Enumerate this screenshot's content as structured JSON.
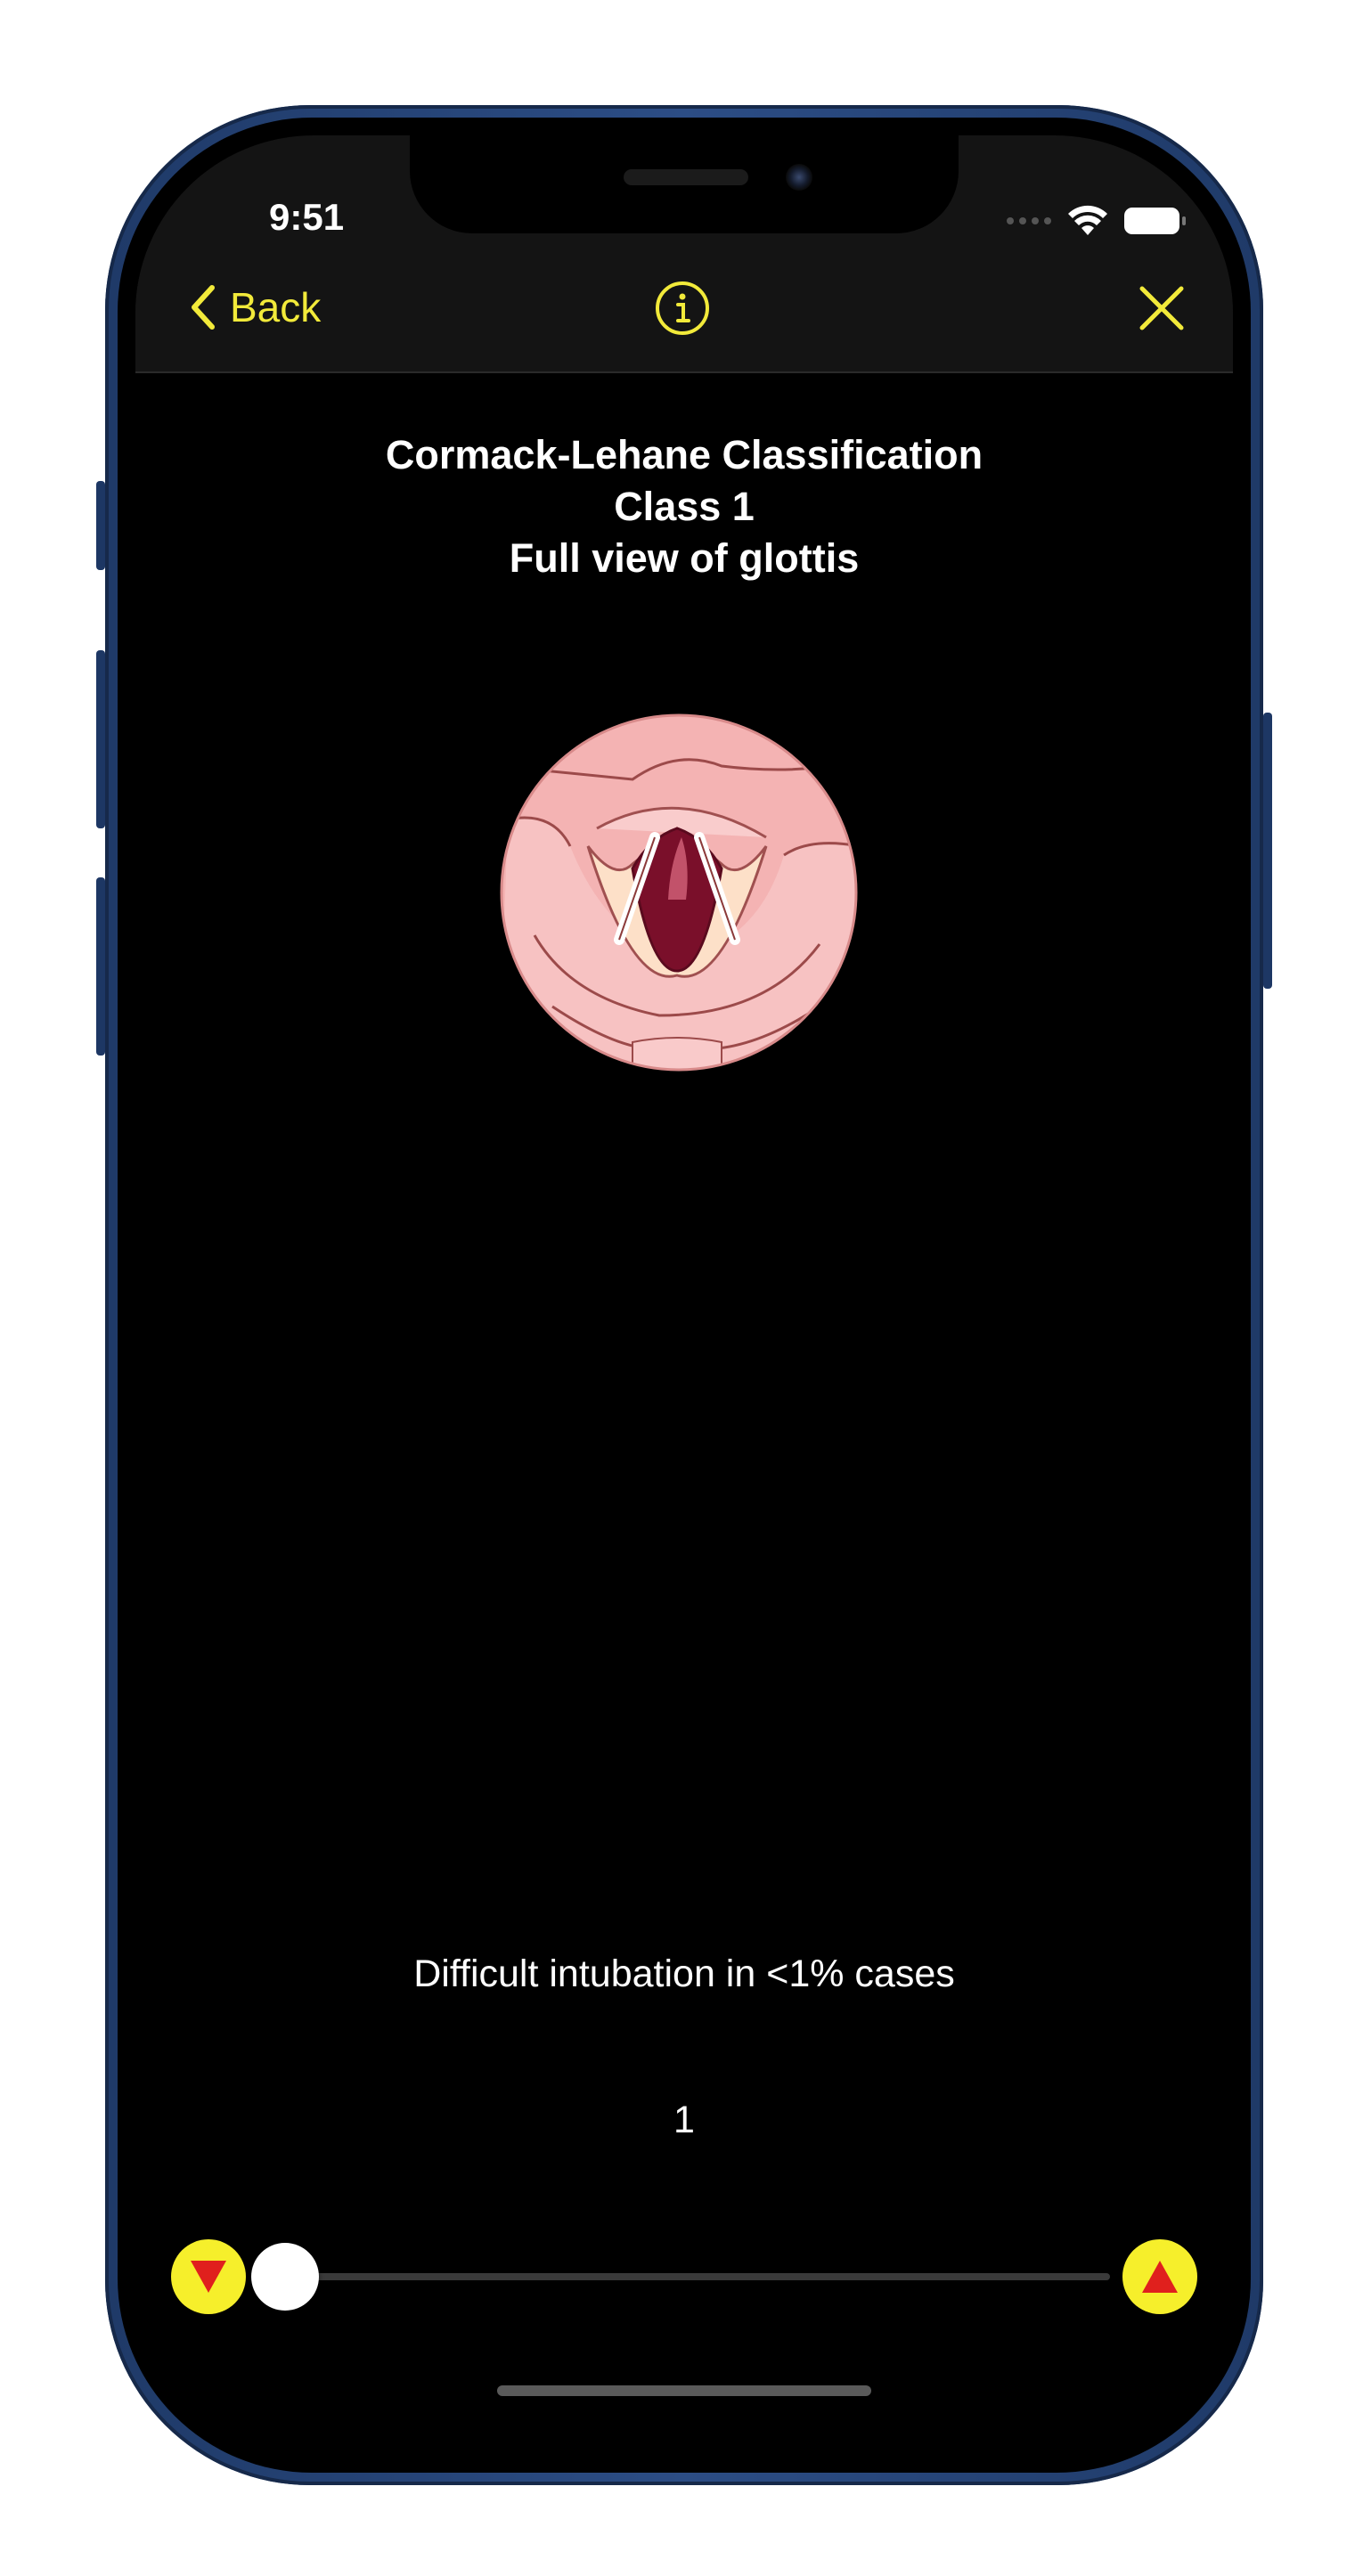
{
  "status_bar": {
    "time": "9:51",
    "signal_icon": "cellular-dots-icon",
    "wifi_icon": "wifi-icon",
    "battery_icon": "battery-icon"
  },
  "nav": {
    "back_label": "Back",
    "back_icon": "chevron-left-icon",
    "info_icon": "info-circle-icon",
    "close_icon": "close-icon",
    "accent_color": "#f2ea3a"
  },
  "content": {
    "title_line1": "Cormack-Lehane Classification",
    "title_line2": "Class 1",
    "title_line3": "Full view of glottis",
    "illustration": "glottis-illustration",
    "description": "Difficult intubation in <1% cases",
    "value_display": "1"
  },
  "slider": {
    "min": 1,
    "max": 4,
    "value": 1,
    "decrement_icon": "triangle-down-icon",
    "increment_icon": "triangle-up-icon",
    "button_color": "#f6ef2b",
    "arrow_color": "#e0201d"
  }
}
